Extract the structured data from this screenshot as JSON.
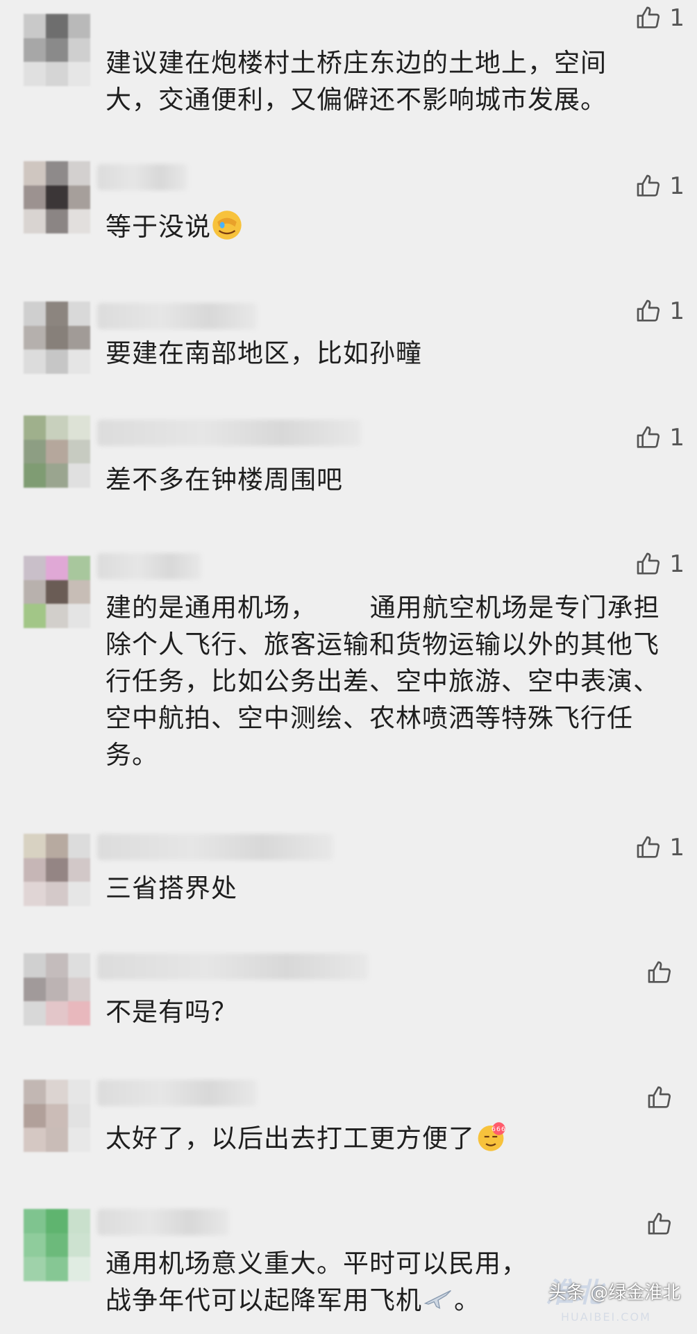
{
  "comments": [
    {
      "text": "建议建在炮楼村土桥庄东边的土地上，空间大，交通便利，又偏僻还不影响城市发展。",
      "likes": "1"
    },
    {
      "text": "等于没说",
      "likes": "1",
      "emoji": "facepalm-emoji"
    },
    {
      "text": "要建在南部地区，比如孙疃",
      "likes": "1"
    },
    {
      "text": "差不多在钟楼周围吧",
      "likes": "1"
    },
    {
      "text": "建的是通用机场，      通用航空机场是专门承担除个人飞行、旅客运输和货物运输以外的其他飞行任务，比如公务出差、空中旅游、空中表演、空中航拍、空中测绘、农林喷洒等特殊飞行任务。",
      "likes": "1"
    },
    {
      "text": "三省搭界处",
      "likes": "1"
    },
    {
      "text": "不是有吗？",
      "likes": ""
    },
    {
      "text": "太好了，以后出去打工更方便了",
      "likes": "",
      "emoji": "666-emoji"
    },
    {
      "text": "通用机场意义重大。平时可以民用，战争年代可以起降军用飞机",
      "likes": "",
      "emoji": "airplane-emoji",
      "suffix": "。"
    }
  ],
  "watermark": {
    "logo": "淮北",
    "url": "HUAIBEI.COM"
  },
  "footer": "头条 @绿金淮北",
  "colors": {
    "background": "#efefef",
    "text": "#1e1e1e",
    "icon": "#555555"
  },
  "icons": {
    "like": "thumbs-up-icon"
  }
}
